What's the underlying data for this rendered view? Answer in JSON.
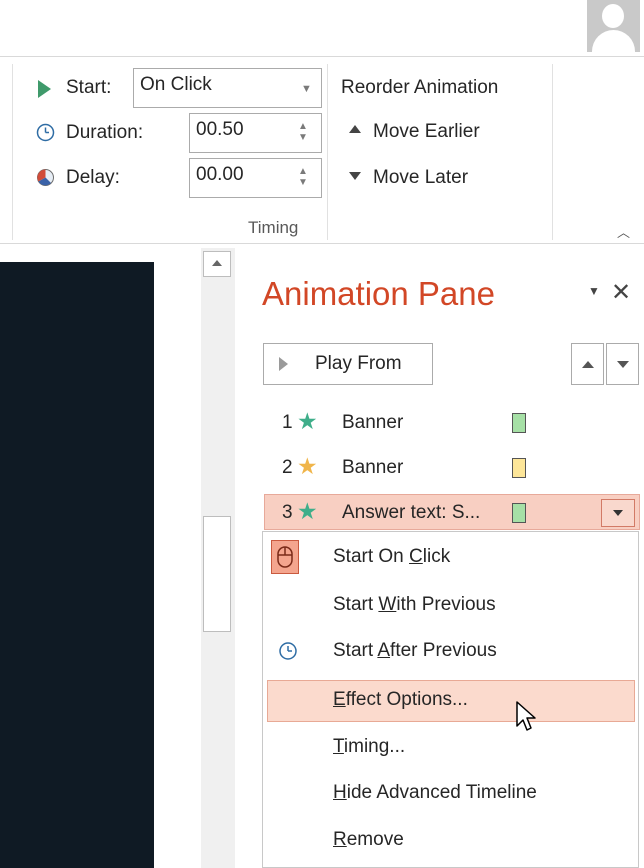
{
  "ribbon": {
    "timing": {
      "start_label": "Start:",
      "start_value": "On Click",
      "duration_label": "Duration:",
      "duration_value": "00.50",
      "delay_label": "Delay:",
      "delay_value": "00.00",
      "group_label": "Timing"
    },
    "reorder": {
      "title": "Reorder Animation",
      "move_earlier": "Move Earlier",
      "move_later": "Move Later"
    }
  },
  "animation_pane": {
    "title": "Animation Pane",
    "play_from_label": "Play From",
    "items": [
      {
        "number": "1",
        "label": "Banner",
        "star_color": "#3fae8a",
        "bar_color": "#a6e0a6"
      },
      {
        "number": "2",
        "label": "Banner",
        "star_color": "#f0b54a",
        "bar_color": "#fde699"
      },
      {
        "number": "3",
        "label": "Answer text: S...",
        "star_color": "#3fae8a",
        "bar_color": "#a6e0a6"
      }
    ]
  },
  "context_menu": {
    "items": [
      {
        "label": "Start On Click",
        "accesskey": "C"
      },
      {
        "label": "Start With Previous",
        "accesskey": "W"
      },
      {
        "label": "Start After Previous",
        "accesskey": "A"
      },
      {
        "label": "Effect Options...",
        "accesskey": "E"
      },
      {
        "label": "Timing...",
        "accesskey": "T"
      },
      {
        "label": "Hide Advanced Timeline",
        "accesskey": "H"
      },
      {
        "label": "Remove",
        "accesskey": "R"
      }
    ]
  },
  "colors": {
    "accent": "#d24726",
    "selection": "#f8cfc2",
    "slide": "#0f1a24"
  }
}
